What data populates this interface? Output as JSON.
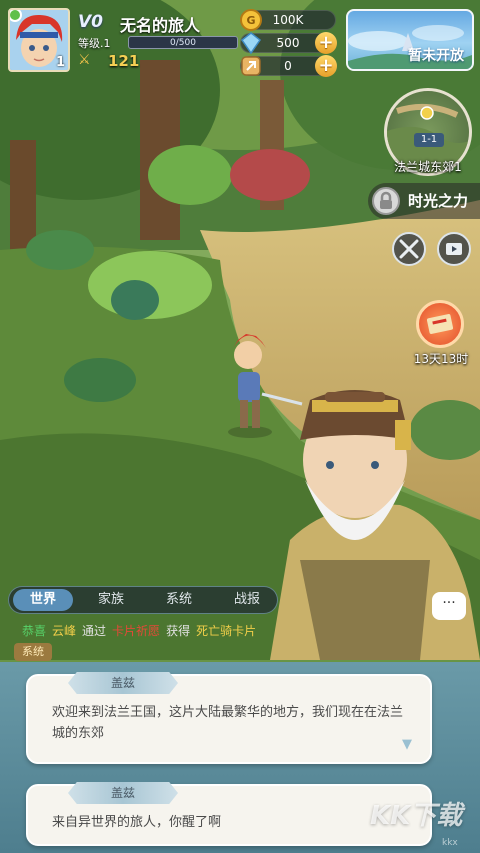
{
  "player": {
    "name": "无名的旅人",
    "vip": "V0",
    "level_label": "等级.1",
    "avatar_level": "1",
    "xp_text": "0/500",
    "xp_fraction": 0,
    "combat_power": "121"
  },
  "currency": {
    "gold": "100K",
    "crystal": "500",
    "token": "0"
  },
  "event_banner": {
    "label": "暂未开放"
  },
  "minimap": {
    "stage": "1-1",
    "location": "法兰城东郊1"
  },
  "time_power": {
    "label": "时光之力"
  },
  "mail": {
    "timer": "13天13时"
  },
  "chat": {
    "tabs": [
      "世界",
      "家族",
      "系统",
      "战报"
    ],
    "active_tab": 0,
    "line": [
      "恭喜",
      "云峰",
      "通过",
      "卡片祈愿",
      "获得",
      "死亡骑卡片"
    ],
    "channel_tag": "系统",
    "bubble": "···"
  },
  "dialogs": [
    {
      "speaker": "盖兹",
      "text": "欢迎来到法兰王国，这片大陆最繁华的地方，我们现在在法兰城的东郊"
    },
    {
      "speaker": "盖兹",
      "text": "来自异世界的旅人，你醒了啊"
    }
  ],
  "watermark": {
    "logo": "KK下载",
    "site": "kkx"
  },
  "colors": {
    "gold": "#f2cf4a",
    "accent_blue": "#5a8fb8",
    "dialog_bg": "#f6f4ee"
  },
  "icons": [
    "online-status-icon",
    "crossed-swords-icon",
    "gold-coin-icon",
    "crystal-icon",
    "token-icon",
    "plus-icon",
    "map-pin-icon",
    "lock-icon",
    "battle-icon",
    "video-icon",
    "mail-icon",
    "chat-bubble-icon",
    "next-arrow-icon"
  ]
}
